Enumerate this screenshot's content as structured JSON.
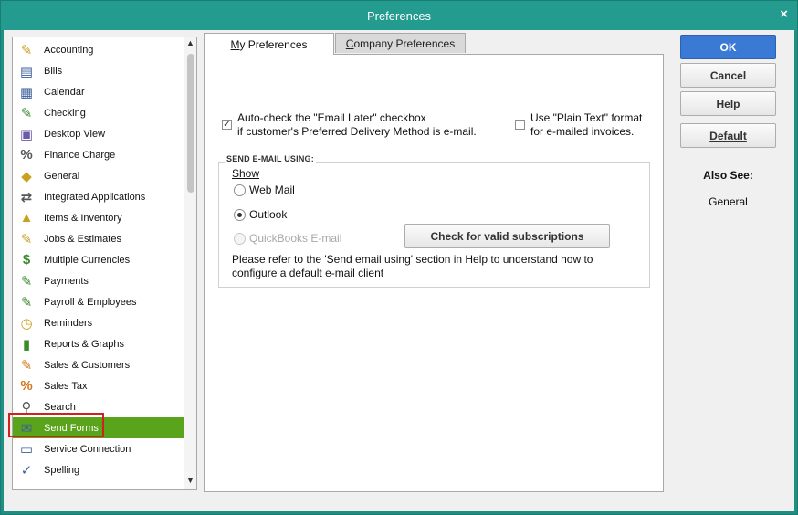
{
  "window": {
    "title": "Preferences",
    "close_glyph": "×"
  },
  "categories": [
    {
      "label": "Accounting",
      "icon": "accounting-icon",
      "glyph": "✎",
      "color": "#c9a020"
    },
    {
      "label": "Bills",
      "icon": "bills-icon",
      "glyph": "▤",
      "color": "#3b5f9a"
    },
    {
      "label": "Calendar",
      "icon": "calendar-icon",
      "glyph": "▦",
      "color": "#3b5f9a"
    },
    {
      "label": "Checking",
      "icon": "checking-icon",
      "glyph": "✎",
      "color": "#3a8a2a"
    },
    {
      "label": "Desktop View",
      "icon": "desktop-view-icon",
      "glyph": "▣",
      "color": "#6a5aa8"
    },
    {
      "label": "Finance Charge",
      "icon": "finance-charge-icon",
      "glyph": "%",
      "color": "#555"
    },
    {
      "label": "General",
      "icon": "general-icon",
      "glyph": "◆",
      "color": "#c9a020"
    },
    {
      "label": "Integrated Applications",
      "icon": "integrated-applications-icon",
      "glyph": "⇄",
      "color": "#555"
    },
    {
      "label": "Items & Inventory",
      "icon": "items-inventory-icon",
      "glyph": "▲",
      "color": "#c9a020"
    },
    {
      "label": "Jobs & Estimates",
      "icon": "jobs-estimates-icon",
      "glyph": "✎",
      "color": "#c9a020"
    },
    {
      "label": "Multiple Currencies",
      "icon": "multiple-currencies-icon",
      "glyph": "$",
      "color": "#3a8a2a"
    },
    {
      "label": "Payments",
      "icon": "payments-icon",
      "glyph": "✎",
      "color": "#3a8a2a"
    },
    {
      "label": "Payroll & Employees",
      "icon": "payroll-employees-icon",
      "glyph": "✎",
      "color": "#3a8a2a"
    },
    {
      "label": "Reminders",
      "icon": "reminders-icon",
      "glyph": "◷",
      "color": "#c9a020"
    },
    {
      "label": "Reports & Graphs",
      "icon": "reports-graphs-icon",
      "glyph": "▮",
      "color": "#3a8a2a"
    },
    {
      "label": "Sales & Customers",
      "icon": "sales-customers-icon",
      "glyph": "✎",
      "color": "#d2761a"
    },
    {
      "label": "Sales Tax",
      "icon": "sales-tax-icon",
      "glyph": "%",
      "color": "#d2761a"
    },
    {
      "label": "Search",
      "icon": "search-icon",
      "glyph": "⚲",
      "color": "#555"
    },
    {
      "label": "Send Forms",
      "icon": "send-forms-icon",
      "glyph": "✉",
      "color": "#3b5f9a"
    },
    {
      "label": "Service Connection",
      "icon": "service-connection-icon",
      "glyph": "▭",
      "color": "#3b5f9a"
    },
    {
      "label": "Spelling",
      "icon": "spelling-icon",
      "glyph": "✓",
      "color": "#3b5f9a"
    }
  ],
  "selected_category": "Send Forms",
  "tabs": {
    "my_prefix": "M",
    "my_rest": "y Preferences",
    "company_prefix": "C",
    "company_rest": "ompany Preferences"
  },
  "options": {
    "email_later_line1": "Auto-check the \"Email Later\" checkbox",
    "email_later_line2": "if customer's Preferred Delivery Method is e-mail.",
    "plain_text_line1": "Use \"Plain Text\" format",
    "plain_text_line2": "for e-mailed invoices."
  },
  "send_email": {
    "group_label": "SEND E-MAIL USING:",
    "show_label": "Show",
    "web_mail": "Web Mail",
    "outlook": "Outlook",
    "quickbooks_email": "QuickBooks E-mail",
    "check_button": "Check for valid subscriptions",
    "help_line1": "Please refer to the 'Send email using' section in Help to understand how to",
    "help_line2": "configure a default e-mail client"
  },
  "buttons": {
    "ok": "OK",
    "cancel": "Cancel",
    "help": "Help",
    "default": "Default"
  },
  "see_also": {
    "heading": "Also See:",
    "link": "General"
  }
}
